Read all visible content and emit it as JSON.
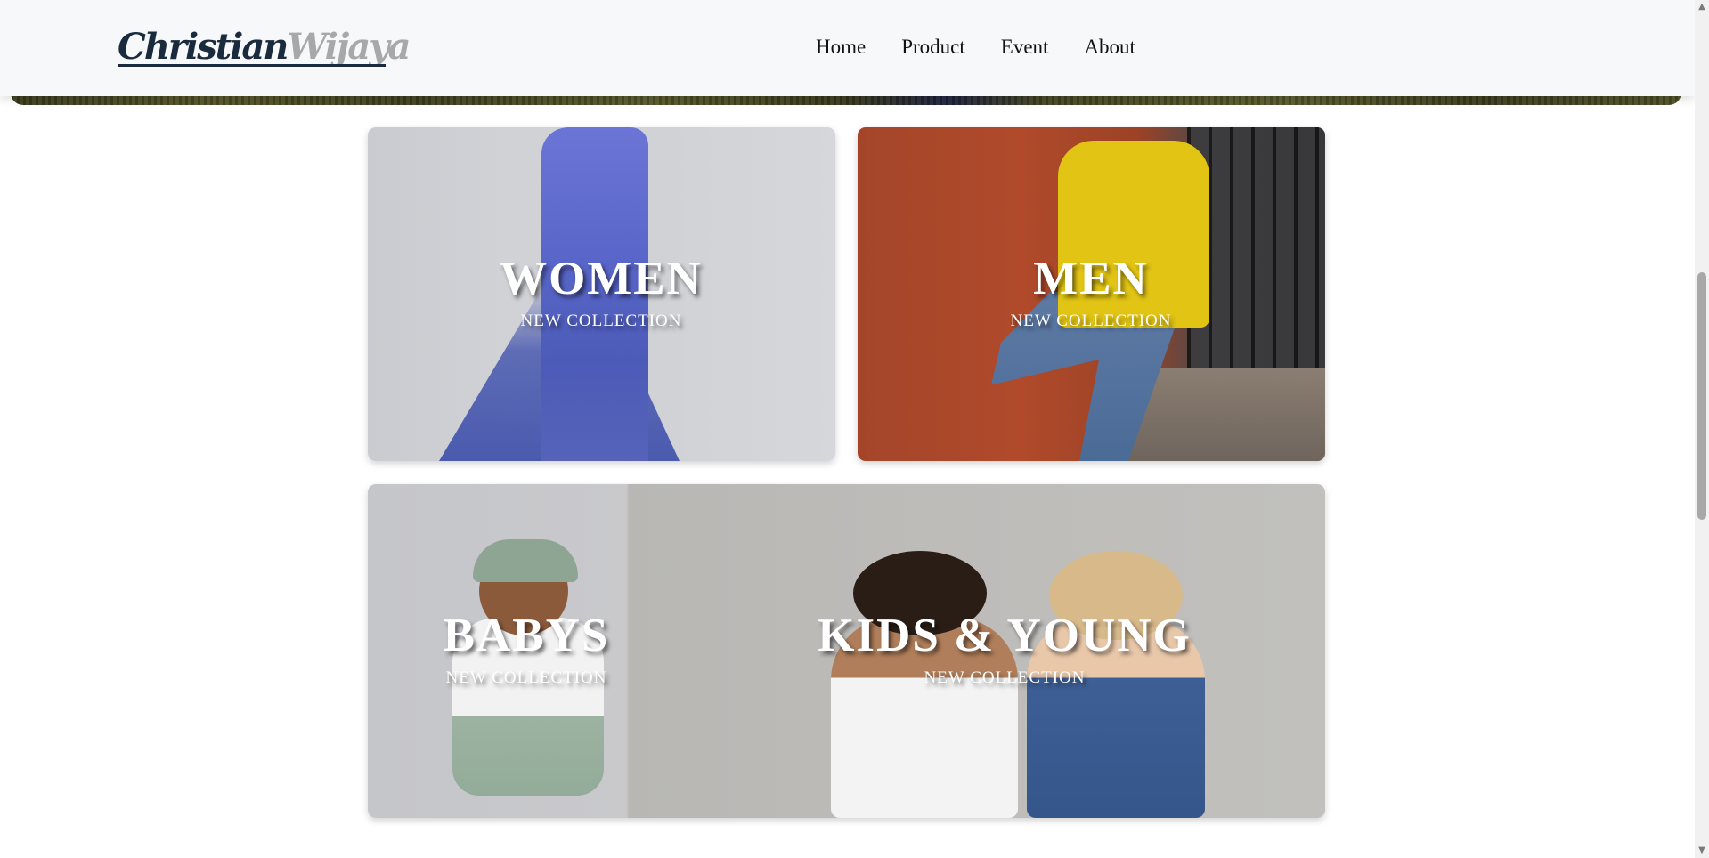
{
  "brand": {
    "first": "Christian",
    "last": "Wijaya"
  },
  "nav": {
    "items": [
      "Home",
      "Product",
      "Event",
      "About"
    ]
  },
  "categories": [
    {
      "title": "WOMEN",
      "subtitle": "NEW COLLECTION"
    },
    {
      "title": "MEN",
      "subtitle": "NEW COLLECTION"
    },
    {
      "title": "BABYS",
      "subtitle": "NEW COLLECTION"
    },
    {
      "title": "KIDS & YOUNG",
      "subtitle": "NEW COLLECTION"
    }
  ],
  "scrollbar": {
    "up_icon": "▲",
    "down_icon": "▼"
  },
  "colors": {
    "navbar_bg": "#f6f8fa",
    "brand_dark": "#1b2b3e",
    "brand_light": "#a8a8a8"
  }
}
